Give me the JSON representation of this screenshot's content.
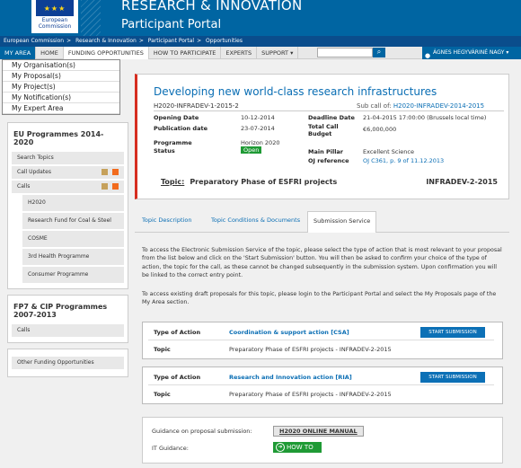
{
  "header": {
    "brand": "RESEARCH & INNOVATION",
    "portal": "Participant Portal",
    "logo_text": "European Commission"
  },
  "breadcrumb": [
    "European Commission",
    "Research & Innovation",
    "Participant Portal",
    "Opportunities"
  ],
  "nav": {
    "my_area": "MY AREA",
    "home": "HOME",
    "funding": "FUNDING OPPORTUNITIES",
    "how": "HOW TO PARTICIPATE",
    "experts": "EXPERTS",
    "support": "SUPPORT ▾",
    "search_placeholder": "",
    "user": "ÁGNES HEGYVÁRINÉ NAGY ▾"
  },
  "dropdown": [
    "My Organisation(s)",
    "My Proposal(s)",
    "My Project(s)",
    "My Notification(s)",
    "My Expert Area"
  ],
  "sidebar": {
    "eu_title": "EU Programmes 2014-2020",
    "search_topics": "Search Topics",
    "call_updates": "Call Updates",
    "calls": "Calls",
    "programmes": [
      "H2020",
      "Research Fund for Coal & Steel",
      "COSME",
      "3rd Health Programme",
      "Consumer Programme"
    ],
    "fp7_title": "FP7 & CIP Programmes 2007-2013",
    "fp7_calls": "Calls",
    "other": "Other Funding Opportunities"
  },
  "topic_card": {
    "title": "Developing new world-class research infrastructures",
    "code": "H2020-INFRADEV-1-2015-2",
    "subcall_prefix": "Sub call of: ",
    "subcall_link": "H2020-INFRADEV-2014-2015",
    "opening_label": "Opening Date",
    "opening": "10-12-2014",
    "publication_label": "Publication date",
    "publication": "23-07-2014",
    "programme_label": "Programme",
    "programme": "Horizon 2020",
    "status_label": "Status",
    "status": "Open",
    "deadline_label": "Deadline Date",
    "deadline": "21-04-2015 17:00:00 (Brussels local time)",
    "budget_label": "Total Call Budget",
    "budget": "€6,000,000",
    "pillar_label": "Main Pillar",
    "pillar": "Excellent Science",
    "oj_label": "OJ reference",
    "oj": "OJ C361, p. 9 of 11.12.2013",
    "topic_label": "Topic:",
    "topic": "Preparatory Phase of ESFRI projects",
    "topic_id": "INFRADEV-2-2015"
  },
  "tabs": [
    "Topic Description",
    "Topic Conditions & Documents",
    "Submission Service"
  ],
  "submission": {
    "para1": "To access the Electronic Submission Service of the topic, please select the type of action that is most relevant to your proposal from the list below and click on the 'Start Submission' button. You will then be asked to confirm your choice of the type of action, the topic for the call, as these cannot be changed subsequently in the submission system. Upon confirmation you will be linked to the correct entry point.",
    "para2": "To access existing draft proposals for this topic, please login to the Participant Portal and select the My Proposals page of the My Area section.",
    "actions": [
      {
        "type_label": "Type of Action",
        "type": "Coordination & support action [CSA]",
        "topic_label": "Topic",
        "topic": "Preparatory Phase of ESFRI projects - INFRADEV-2-2015",
        "button": "START SUBMISSION"
      },
      {
        "type_label": "Type of Action",
        "type": "Research and Innovation action [RIA]",
        "topic_label": "Topic",
        "topic": "Preparatory Phase of ESFRI projects - INFRADEV-2-2015",
        "button": "START SUBMISSION"
      }
    ],
    "guidance_label": "Guidance on proposal submission:",
    "manual": "H2020 ONLINE MANUAL",
    "it_label": "IT Guidance:",
    "howto": "HOW TO"
  }
}
